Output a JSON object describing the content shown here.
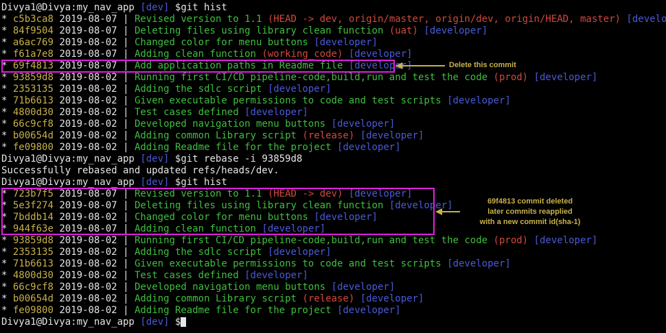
{
  "terminal": {
    "lines": [
      {
        "type": "prompt",
        "user": "Divya1@Divya:my_nav_app",
        "branch": "[dev]",
        "cmd": "$git hist"
      },
      {
        "type": "commit",
        "hash": "c5b3ca8",
        "date": "2019-08-07",
        "msg": "Revised version to 1.1",
        "ref": "(HEAD -> dev, origin/master, origin/dev, origin/HEAD, master)",
        "author": "[developer]"
      },
      {
        "type": "commit",
        "hash": "84f9504",
        "date": "2019-08-07",
        "msg": "Deleting files using library clean function",
        "ref": "(uat)",
        "author": "[developer]"
      },
      {
        "type": "commit",
        "hash": "a6ac769",
        "date": "2019-08-02",
        "msg": "Changed color for menu buttons",
        "ref": "",
        "author": "[developer]"
      },
      {
        "type": "commit",
        "hash": "f61a7e8",
        "date": "2019-08-07",
        "msg": "Adding clean function",
        "ref": "(working_code)",
        "author": "[developer]"
      },
      {
        "type": "commit",
        "hash": "69f4813",
        "date": "2019-08-07",
        "msg": "Add application paths in Readme file",
        "ref": "",
        "author": "[developer]"
      },
      {
        "type": "commit",
        "hash": "93859d8",
        "date": "2019-08-02",
        "msg": "Running first CI/CD pipeline-code,build,run and test the code",
        "ref": "(prod)",
        "author": "[developer]"
      },
      {
        "type": "commit",
        "hash": "2353135",
        "date": "2019-08-02",
        "msg": "Adding the sdlc script",
        "ref": "",
        "author": "[developer]"
      },
      {
        "type": "commit",
        "hash": "71b6613",
        "date": "2019-08-02",
        "msg": "Given executable permissions to code and test scripts",
        "ref": "",
        "author": "[developer]"
      },
      {
        "type": "commit",
        "hash": "4800d30",
        "date": "2019-08-02",
        "msg": "Test cases defined",
        "ref": "",
        "author": "[developer]"
      },
      {
        "type": "commit",
        "hash": "66c9cf8",
        "date": "2019-08-02",
        "msg": "Developed navigation menu buttons",
        "ref": "",
        "author": "[developer]"
      },
      {
        "type": "commit",
        "hash": "b00654d",
        "date": "2019-08-02",
        "msg": "Adding common Library script",
        "ref": "(release)",
        "author": "[developer]"
      },
      {
        "type": "commit",
        "hash": "fe09800",
        "date": "2019-08-02",
        "msg": "Adding Readme file for the project",
        "ref": "",
        "author": "[developer]"
      },
      {
        "type": "prompt",
        "user": "Divya1@Divya:my_nav_app",
        "branch": "[dev]",
        "cmd": "$git rebase -i 93859d8"
      },
      {
        "type": "text",
        "text": "Successfully rebased and updated refs/heads/dev."
      },
      {
        "type": "prompt",
        "user": "Divya1@Divya:my_nav_app",
        "branch": "[dev]",
        "cmd": "$git hist"
      },
      {
        "type": "commit",
        "hash": "723b7f5",
        "date": "2019-08-07",
        "msg": "Revised version to 1.1",
        "ref": "(HEAD -> dev)",
        "author": "[developer]"
      },
      {
        "type": "commit",
        "hash": "5e3f274",
        "date": "2019-08-07",
        "msg": "Deleting files using library clean function",
        "ref": "",
        "author": "[developer]"
      },
      {
        "type": "commit",
        "hash": "7bddb14",
        "date": "2019-08-02",
        "msg": "Changed color for menu buttons",
        "ref": "",
        "author": "[developer]"
      },
      {
        "type": "commit",
        "hash": "944f63e",
        "date": "2019-08-07",
        "msg": "Adding clean function",
        "ref": "",
        "author": "[developer]"
      },
      {
        "type": "commit",
        "hash": "93859d8",
        "date": "2019-08-02",
        "msg": "Running first CI/CD pipeline-code,build,run and test the code",
        "ref": "(prod)",
        "author": "[developer]"
      },
      {
        "type": "commit",
        "hash": "2353135",
        "date": "2019-08-02",
        "msg": "Adding the sdlc script",
        "ref": "",
        "author": "[developer]"
      },
      {
        "type": "commit",
        "hash": "71b6613",
        "date": "2019-08-02",
        "msg": "Given executable permissions to code and test scripts",
        "ref": "",
        "author": "[developer]"
      },
      {
        "type": "commit",
        "hash": "4800d30",
        "date": "2019-08-02",
        "msg": "Test cases defined",
        "ref": "",
        "author": "[developer]"
      },
      {
        "type": "commit",
        "hash": "66c9cf8",
        "date": "2019-08-02",
        "msg": "Developed navigation menu buttons",
        "ref": "",
        "author": "[developer]"
      },
      {
        "type": "commit",
        "hash": "b00654d",
        "date": "2019-08-02",
        "msg": "Adding common Library script",
        "ref": "(release)",
        "author": "[developer]"
      },
      {
        "type": "commit",
        "hash": "fe09800",
        "date": "2019-08-02",
        "msg": "Adding Readme file for the project",
        "ref": "",
        "author": "[developer]"
      },
      {
        "type": "prompt",
        "user": "Divya1@Divya:my_nav_app",
        "branch": "[dev]",
        "cmd": "$",
        "cursor": true
      }
    ]
  },
  "annotations": {
    "delete_note": "Delete this commit",
    "reapply_note": [
      "69f4813 commit deleted",
      "later commits reapplied",
      "with a new commit id(sha-1)"
    ]
  },
  "colors": {
    "hash": "#c9b14a",
    "message": "#3fbf3f",
    "ref": "#d04a3a",
    "author": "#4a5ad8",
    "highlight_box": "#e020e0",
    "annotation": "#c9b14a"
  }
}
